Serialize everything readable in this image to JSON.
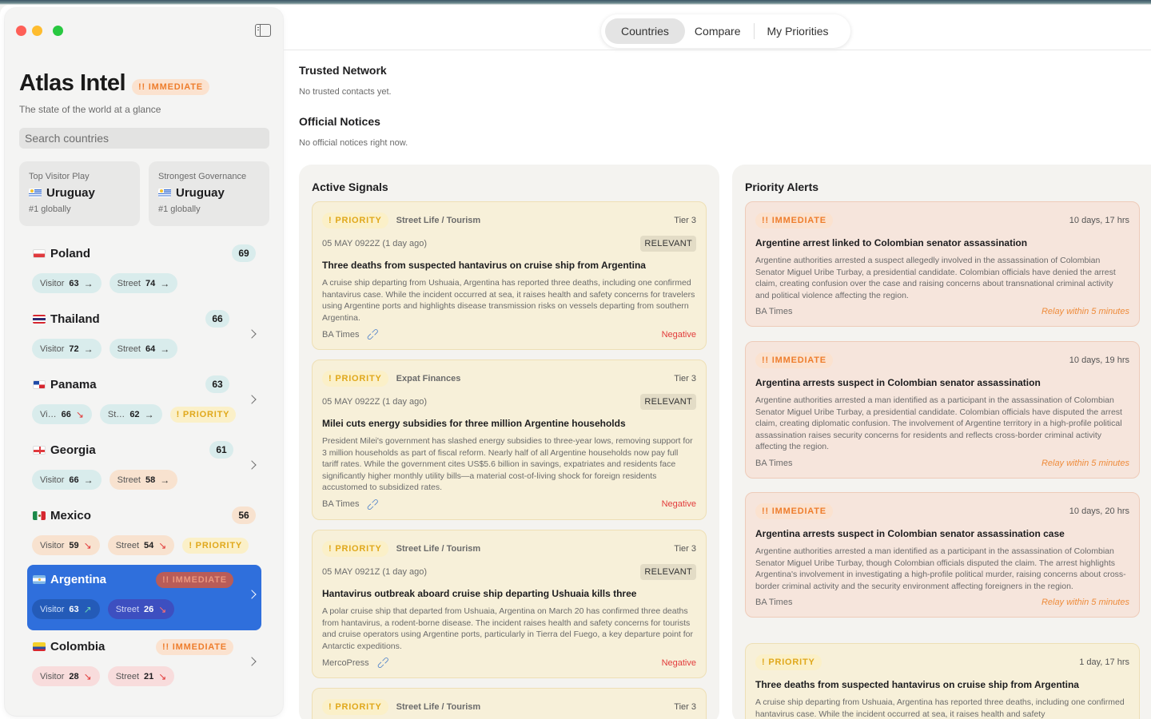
{
  "app": {
    "title": "Atlas Intel",
    "title_badge": "!! IMMEDIATE",
    "tagline": "The state of the world at a glance",
    "search_placeholder": "Search countries"
  },
  "stats": [
    {
      "label": "Top Visitor Play",
      "value": "Uruguay",
      "sub": "#1 globally"
    },
    {
      "label": "Strongest Governance",
      "value": "Uruguay",
      "sub": "#1 globally"
    }
  ],
  "countries": [
    {
      "name": "Poland",
      "score": "69",
      "visitor": "63",
      "street": "74",
      "visitor_label": "Visitor",
      "street_label": "Street",
      "badge": ""
    },
    {
      "name": "Thailand",
      "score": "66",
      "visitor": "72",
      "street": "64",
      "visitor_label": "Visitor",
      "street_label": "Street",
      "badge": ""
    },
    {
      "name": "Panama",
      "score": "63",
      "visitor": "66",
      "street": "62",
      "visitor_label": "Vi…",
      "street_label": "St…",
      "badge": "! PRIORITY"
    },
    {
      "name": "Georgia",
      "score": "61",
      "visitor": "66",
      "street": "58",
      "visitor_label": "Visitor",
      "street_label": "Street",
      "badge": ""
    },
    {
      "name": "Mexico",
      "score": "56",
      "visitor": "59",
      "street": "54",
      "visitor_label": "Visitor",
      "street_label": "Street",
      "badge": "! PRIORITY"
    },
    {
      "name": "Argentina",
      "score": "",
      "visitor": "63",
      "street": "26",
      "visitor_label": "Visitor",
      "street_label": "Street",
      "badge": "!! IMMEDIATE"
    },
    {
      "name": "Colombia",
      "score": "",
      "visitor": "28",
      "street": "21",
      "visitor_label": "Visitor",
      "street_label": "Street",
      "badge": "!! IMMEDIATE"
    }
  ],
  "nav": {
    "tabs": [
      "Countries",
      "Compare",
      "My Priorities"
    ]
  },
  "trusted": {
    "title": "Trusted Network",
    "empty": "No trusted contacts yet."
  },
  "notices": {
    "title": "Official Notices",
    "empty": "No official notices right now."
  },
  "signals": {
    "title": "Active Signals",
    "cards": [
      {
        "badge": "! PRIORITY",
        "category": "Street Life / Tourism",
        "tier": "Tier 3",
        "date": "05 MAY 0922Z (1 day ago)",
        "tag": "RELEVANT",
        "title": "Three deaths from suspected hantavirus on cruise ship from Argentina",
        "body": "A cruise ship departing from Ushuaia, Argentina has reported three deaths, including one confirmed hantavirus case. While the incident occurred at sea, it raises health and safety concerns for travelers using Argentine ports and highlights disease transmission risks on vessels departing from southern Argentina.",
        "source": "BA Times",
        "sentiment": "Negative"
      },
      {
        "badge": "! PRIORITY",
        "category": "Expat Finances",
        "tier": "Tier 3",
        "date": "05 MAY 0922Z (1 day ago)",
        "tag": "RELEVANT",
        "title": "Milei cuts energy subsidies for three million Argentine households",
        "body": "President Milei's government has slashed energy subsidies to three-year lows, removing support for 3 million households as part of fiscal reform. Nearly half of all Argentine households now pay full tariff rates. While the government cites US$5.6 billion in savings, expatriates and residents face significantly higher monthly utility bills—a material cost-of-living shock for foreign residents accustomed to subsidized rates.",
        "source": "BA Times",
        "sentiment": "Negative"
      },
      {
        "badge": "! PRIORITY",
        "category": "Street Life / Tourism",
        "tier": "Tier 3",
        "date": "05 MAY 0921Z (1 day ago)",
        "tag": "RELEVANT",
        "title": "Hantavirus outbreak aboard cruise ship departing Ushuaia kills three",
        "body": "A polar cruise ship that departed from Ushuaia, Argentina on March 20 has confirmed three deaths from hantavirus, a rodent-borne disease. The incident raises health and safety concerns for tourists and cruise operators using Argentine ports, particularly in Tierra del Fuego, a key departure point for Antarctic expeditions.",
        "source": "MercoPress",
        "sentiment": "Negative"
      },
      {
        "badge": "! PRIORITY",
        "category": "Street Life / Tourism",
        "tier": "Tier 3"
      }
    ]
  },
  "alerts": {
    "title": "Priority Alerts",
    "cards": [
      {
        "badge": "!! IMMEDIATE",
        "time": "10 days, 17 hrs",
        "title": "Argentine arrest linked to Colombian senator assassination",
        "body": "Argentine authorities arrested a suspect allegedly involved in the assassination of Colombian Senator Miguel Uribe Turbay, a presidential candidate. Colombian officials have denied the arrest claim, creating confusion over the case and raising concerns about transnational criminal activity and political violence affecting the region.",
        "source": "BA Times",
        "relay": "Relay within 5 minutes"
      },
      {
        "badge": "!! IMMEDIATE",
        "time": "10 days, 19 hrs",
        "title": "Argentina arrests suspect in Colombian senator assassination",
        "body": "Argentine authorities arrested a man identified as a participant in the assassination of Colombian Senator Miguel Uribe Turbay, a presidential candidate. Colombian officials have disputed the arrest claim, creating diplomatic confusion. The involvement of Argentine territory in a high-profile political assassination raises security concerns for residents and reflects cross-border criminal activity affecting the region.",
        "source": "BA Times",
        "relay": "Relay within 5 minutes"
      },
      {
        "badge": "!! IMMEDIATE",
        "time": "10 days, 20 hrs",
        "title": "Argentina arrests suspect in Colombian senator assassination case",
        "body": "Argentine authorities arrested a man identified as a participant in the assassination of Colombian Senator Miguel Uribe Turbay, though Colombian officials disputed the claim. The arrest highlights Argentina's involvement in investigating a high-profile political murder, raising concerns about cross-border criminal activity and the security environment affecting foreigners in the region.",
        "source": "BA Times",
        "relay": "Relay within 5 minutes"
      },
      {
        "badge": "! PRIORITY",
        "time": "1 day, 17 hrs",
        "title": "Three deaths from suspected hantavirus on cruise ship from Argentina",
        "body": "A cruise ship departing from Ushuaia, Argentina has reported three deaths, including one confirmed hantavirus case. While the incident occurred at sea, it raises health and safety"
      }
    ]
  },
  "colors": {
    "accent": "#2f6fdc",
    "immediate": "#ee7d2c",
    "priority": "#e0a81b",
    "negative": "#e23c3c"
  }
}
